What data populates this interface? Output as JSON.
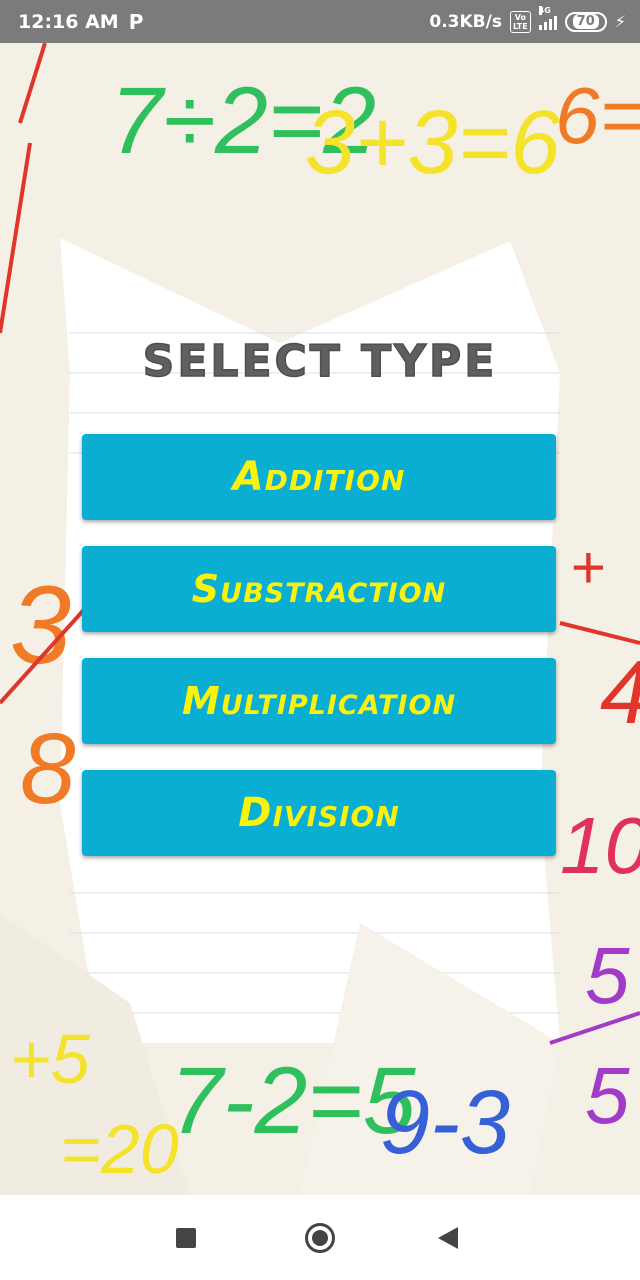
{
  "status_bar": {
    "time": "12:16 AM",
    "notification_icon": "P",
    "net_speed": "0.3KB/s",
    "volte": "Vo LTE",
    "network": "4G",
    "battery": "70",
    "charging_icon": "lightning-bolt"
  },
  "screen": {
    "title": "SELECT TYPE",
    "buttons": {
      "addition": "Addition",
      "subtraction": "Substraction",
      "multiplication": "Multiplication",
      "division": "Division"
    }
  },
  "background": {
    "equations": [
      "7÷2=2",
      "3+3=6",
      "6=",
      "7-2=5",
      "9-3",
      "10",
      "5",
      "5",
      "+",
      "4",
      "3",
      "8",
      "+5",
      "=20"
    ]
  },
  "colors": {
    "button_bg": "#0aaed3",
    "button_text": "#f8f20c",
    "title_text": "#5f5f5f",
    "status_bar": "#7b7b7b"
  },
  "nav_bar": {
    "icons": [
      "recents-square",
      "home-circle",
      "back-triangle"
    ]
  }
}
